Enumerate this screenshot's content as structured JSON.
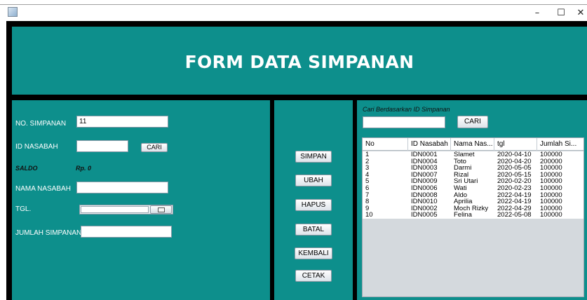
{
  "window": {
    "minimize_glyph": "–",
    "maximize_glyph": "☐",
    "close_glyph": "✕"
  },
  "header": {
    "title": "FORM DATA SIMPANAN"
  },
  "form": {
    "no_simpanan_label": "NO. SIMPANAN",
    "no_simpanan_value": "11",
    "id_nasabah_label": "ID NASABAH",
    "id_nasabah_value": "",
    "cari_label": "CARI",
    "saldo_label": "SALDO",
    "saldo_value": "Rp. 0",
    "nama_nasabah_label": "NAMA NASABAH",
    "nama_nasabah_value": "",
    "tgl_label": "TGL.",
    "tgl_value": "",
    "jumlah_simpanan_label": "JUMLAH SIMPANAN",
    "jumlah_simpanan_value": ""
  },
  "actions": {
    "simpan": "SIMPAN",
    "ubah": "UBAH",
    "hapus": "HAPUS",
    "batal": "BATAL",
    "kembali": "KEMBALI",
    "cetak": "CETAK"
  },
  "search": {
    "caption": "Cari Berdasarkan ID Simpanan",
    "value": "",
    "button": "CARI"
  },
  "table": {
    "columns": [
      "No",
      "ID Nasabah",
      "Nama Nas...",
      "tgl",
      "Jumlah Si..."
    ],
    "rows": [
      [
        "1",
        "IDN0001",
        "Slamet",
        "2020-04-10",
        "100000"
      ],
      [
        "2",
        "IDN0004",
        "Toto",
        "2020-04-20",
        "200000"
      ],
      [
        "3",
        "IDN0003",
        "Darmi",
        "2020-05-05",
        "100000"
      ],
      [
        "4",
        "IDN0007",
        "Rizal",
        "2020-05-15",
        "100000"
      ],
      [
        "5",
        "IDN0009",
        "Sri Utari",
        "2020-02-20",
        "100000"
      ],
      [
        "6",
        "IDN0006",
        "Wati",
        "2020-02-23",
        "100000"
      ],
      [
        "7",
        "IDN0008",
        "Aldo",
        "2022-04-19",
        "100000"
      ],
      [
        "8",
        "IDN0010",
        "Aprilia",
        "2022-04-19",
        "100000"
      ],
      [
        "9",
        "IDN0002",
        "Moch Rizky",
        "2022-04-29",
        "100000"
      ],
      [
        "10",
        "IDN0005",
        "Felina",
        "2022-05-08",
        "100000"
      ]
    ]
  },
  "colors": {
    "panel": "#0d8f8c",
    "frame": "#000000",
    "header_text": "#ffffff"
  }
}
